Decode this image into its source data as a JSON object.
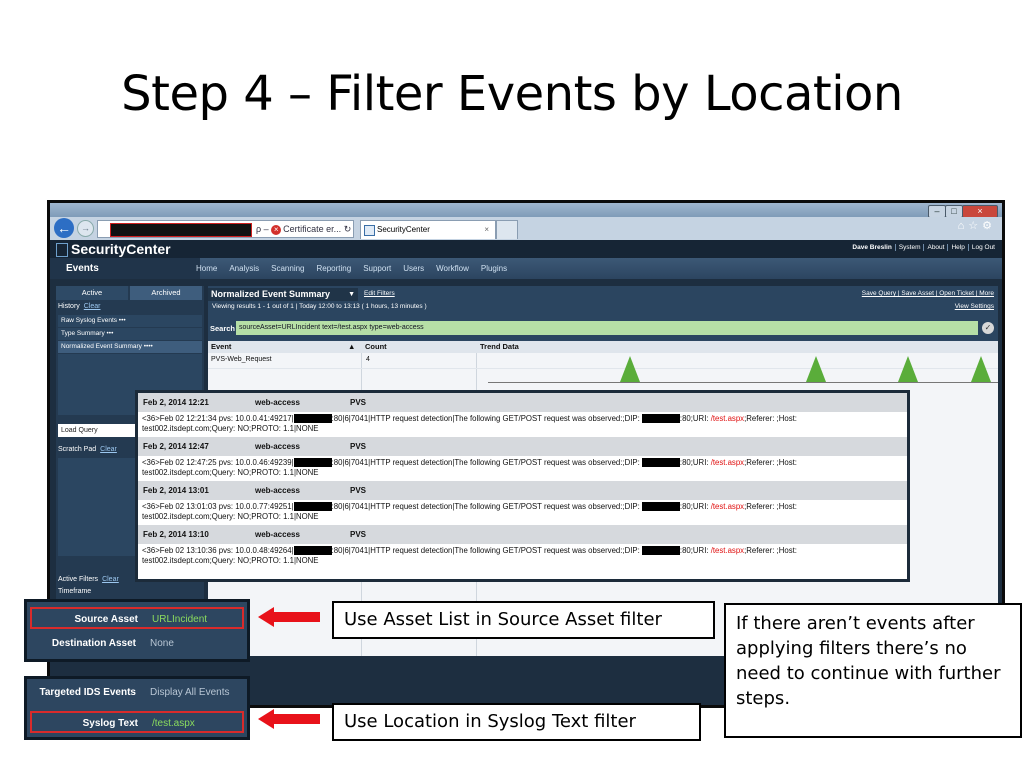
{
  "slide": {
    "title": "Step 4 – Filter Events by Location"
  },
  "browser": {
    "tab_title": "SecurityCenter",
    "address_suffix": "ρ –",
    "cert_warning": "Certificate er...",
    "window_controls": {
      "minimize": "–",
      "maximize": "□",
      "close": "×"
    },
    "toolbar_icons": "⌂☆⚙"
  },
  "app": {
    "logo": "SecurityCenter",
    "user_links": [
      "Dave Breslin",
      "System",
      "About",
      "Help",
      "Log Out"
    ],
    "section": "Events",
    "nav": [
      "Home",
      "Analysis",
      "Scanning",
      "Reporting",
      "Support",
      "Users",
      "Workflow",
      "Plugins"
    ],
    "sidebar": {
      "tabs": [
        "Active",
        "Archived"
      ],
      "history_label": "History",
      "clear": "Clear",
      "history_items": [
        "Raw Syslog Events •••",
        "Type Summary •••",
        "Normalized Event Summary ••••"
      ],
      "load_query": "Load Query",
      "scratch_pad": "Scratch Pad",
      "active_filters": "Active Filters",
      "timeframe": "Timeframe"
    },
    "main": {
      "summary_select": "Normalized Event Summary",
      "edit_filters": "Edit Filters",
      "viewing": "Viewing results 1 - 1 out of 1  |  Today 12:00 to 13:13  ( 1 hours, 13 minutes )",
      "right_links": "Save Query | Save Asset | Open Ticket | More",
      "view_settings": "View Settings",
      "search_label": "Search",
      "search_value": "sourceAsset=URLIncident text=/test.aspx type=web-access",
      "columns": [
        "Event",
        "Count",
        "Trend Data"
      ],
      "rows": [
        {
          "event": "PVS-Web_Request",
          "count": "4"
        }
      ]
    }
  },
  "events": [
    {
      "date": "Feb 2, 2014 12:21",
      "type": "web-access",
      "source": "PVS",
      "pre": "<36>Feb 02 12:21:34 pvs: 10.0.0.41:49217|",
      "mid": ":80|6|7041|HTTP request detection|The following GET/POST request was observed:;DIP: ",
      "post": ":80;URI: ",
      "uri": "/test.aspx",
      "tail": ";Referer: ;Host:",
      "line2": "test002.itsdept.com;Query: NO;PROTO: 1.1|NONE"
    },
    {
      "date": "Feb 2, 2014 12:47",
      "type": "web-access",
      "source": "PVS",
      "pre": "<36>Feb 02 12:47:25 pvs: 10.0.0.46:49239|",
      "mid": ":80|6|7041|HTTP request detection|The following GET/POST request was observed:;DIP: ",
      "post": ":80;URI: ",
      "uri": "/test.aspx",
      "tail": ";Referer: ;Host:",
      "line2": "test002.itsdept.com;Query: NO;PROTO: 1.1|NONE"
    },
    {
      "date": "Feb 2, 2014 13:01",
      "type": "web-access",
      "source": "PVS",
      "pre": "<36>Feb 02 13:01:03 pvs: 10.0.0.77:49251|",
      "mid": ":80|6|7041|HTTP request detection|The following GET/POST request was observed:;DIP: ",
      "post": ":80;URI: ",
      "uri": "/test.aspx",
      "tail": ";Referer: ;Host:",
      "line2": "test002.itsdept.com;Query: NO;PROTO: 1.1|NONE"
    },
    {
      "date": "Feb 2, 2014 13:10",
      "type": "web-access",
      "source": "PVS",
      "pre": "<36>Feb 02 13:10:36 pvs: 10.0.0.48:49264|",
      "mid": ":80|6|7041|HTTP request detection|The following GET/POST request was observed:;DIP: ",
      "post": ":80;URI: ",
      "uri": "/test.aspx",
      "tail": ";Referer: ;Host:",
      "line2": "test002.itsdept.com;Query: NO;PROTO: 1.1|NONE"
    }
  ],
  "filters": {
    "source_asset": {
      "label": "Source Asset",
      "value": "URLIncident"
    },
    "destination_asset": {
      "label": "Destination Asset",
      "value": "None"
    },
    "targeted_ids": {
      "label": "Targeted IDS Events",
      "value": "Display All Events"
    },
    "syslog_text": {
      "label": "Syslog Text",
      "value": "/test.aspx"
    }
  },
  "callouts": {
    "asset_list": "Use Asset List in Source Asset filter",
    "location": "Use Location in Syslog Text filter",
    "no_events": "If there aren’t events after applying filters there’s no need to continue with further steps."
  },
  "colors": {
    "accent_red": "#e8121a",
    "filter_green": "#8bdc5e",
    "trend_green": "#5aad3a",
    "app_navy": "#1d2e40"
  }
}
